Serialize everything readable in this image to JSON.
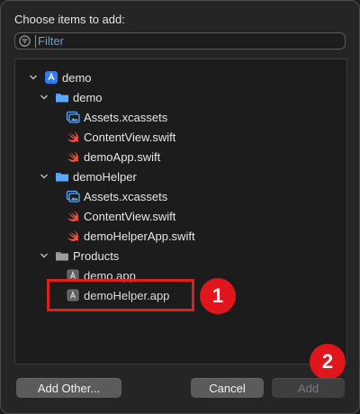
{
  "dialog": {
    "title": "Choose items to add:",
    "filter_placeholder": "Filter"
  },
  "tree": [
    {
      "label": "demo"
    },
    {
      "label": "demo"
    },
    {
      "label": "Assets.xcassets"
    },
    {
      "label": "ContentView.swift"
    },
    {
      "label": "demoApp.swift"
    },
    {
      "label": "demoHelper"
    },
    {
      "label": "Assets.xcassets"
    },
    {
      "label": "ContentView.swift"
    },
    {
      "label": "demoHelperApp.swift"
    },
    {
      "label": "Products"
    },
    {
      "label": "demo.app"
    },
    {
      "label": "demoHelper.app"
    }
  ],
  "annotations": {
    "badge1": "1",
    "badge2": "2"
  },
  "buttons": {
    "add_other": "Add Other...",
    "cancel": "Cancel",
    "add": "Add"
  },
  "colors": {
    "folder_blue": "#4a9bff",
    "swift_orange": "#f05138",
    "highlight_red": "#e0201b"
  }
}
